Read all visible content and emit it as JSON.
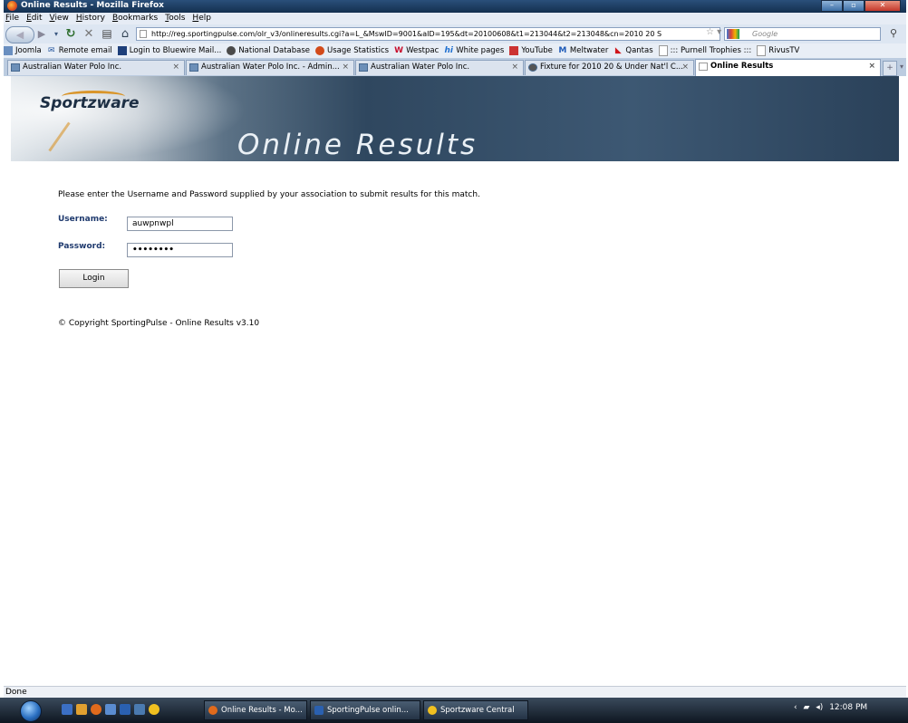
{
  "window": {
    "title": "Online Results - Mozilla Firefox"
  },
  "menu": [
    "File",
    "Edit",
    "View",
    "History",
    "Bookmarks",
    "Tools",
    "Help"
  ],
  "address": {
    "url": "http://reg.sportingpulse.com/olr_v3/onlineresults.cgi?a=L_&MswID=9001&aID=195&dt=20100608&t1=213044&t2=213048&cn=2010 20 S",
    "search_placeholder": "Google"
  },
  "bookmarks": [
    "Joomla",
    "Remote email",
    "Login to Bluewire Mail...",
    "National Database",
    "Usage Statistics",
    "Westpac",
    "White pages",
    "YouTube",
    "Meltwater",
    "Qantas",
    "::: Purnell Trophies :::",
    "RivusTV"
  ],
  "tabs": [
    "Australian Water Polo Inc.",
    "Australian Water Polo Inc. - Admin...",
    "Australian Water Polo Inc.",
    "Fixture for 2010 20 & Under Nat'l C...",
    "Online Results"
  ],
  "page": {
    "logo": "Sportzware",
    "banner_title": "Online Results",
    "intro": "Please enter the Username and Password supplied by your association to submit results for this match.",
    "username_label": "Username:",
    "username_value": "auwpnwpl",
    "password_label": "Password:",
    "password_value": "••••••••",
    "login_button": "Login",
    "copyright": "© Copyright SportingPulse - Online Results v3.10"
  },
  "status": "Done",
  "taskbar": {
    "tasks": [
      "Online Results - Mo...",
      "SportingPulse onlin...",
      "Sportzware Central"
    ],
    "clock": "12:08 PM"
  }
}
